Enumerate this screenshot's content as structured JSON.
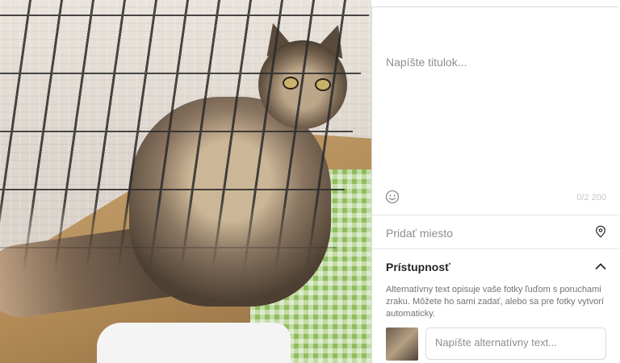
{
  "caption": {
    "placeholder": "Napíšte titulok...",
    "counter": "0/2 200"
  },
  "location": {
    "placeholder": "Pridať miesto"
  },
  "accessibility": {
    "title": "Prístupnosť",
    "description": "Alternatívny text opisuje vaše fotky ľuďom s poruchami zraku. Môžete ho sami zadať, alebo sa pre fotky vytvorí automaticky.",
    "alt_placeholder": "Napíšte alternatívny text..."
  },
  "icons": {
    "emoji": "emoji-icon",
    "location": "location-pin-icon",
    "collapse": "chevron-up-icon"
  },
  "colors": {
    "placeholder_text": "#8e8e8e",
    "border": "#dbdbdb",
    "heading_text": "#262626"
  }
}
